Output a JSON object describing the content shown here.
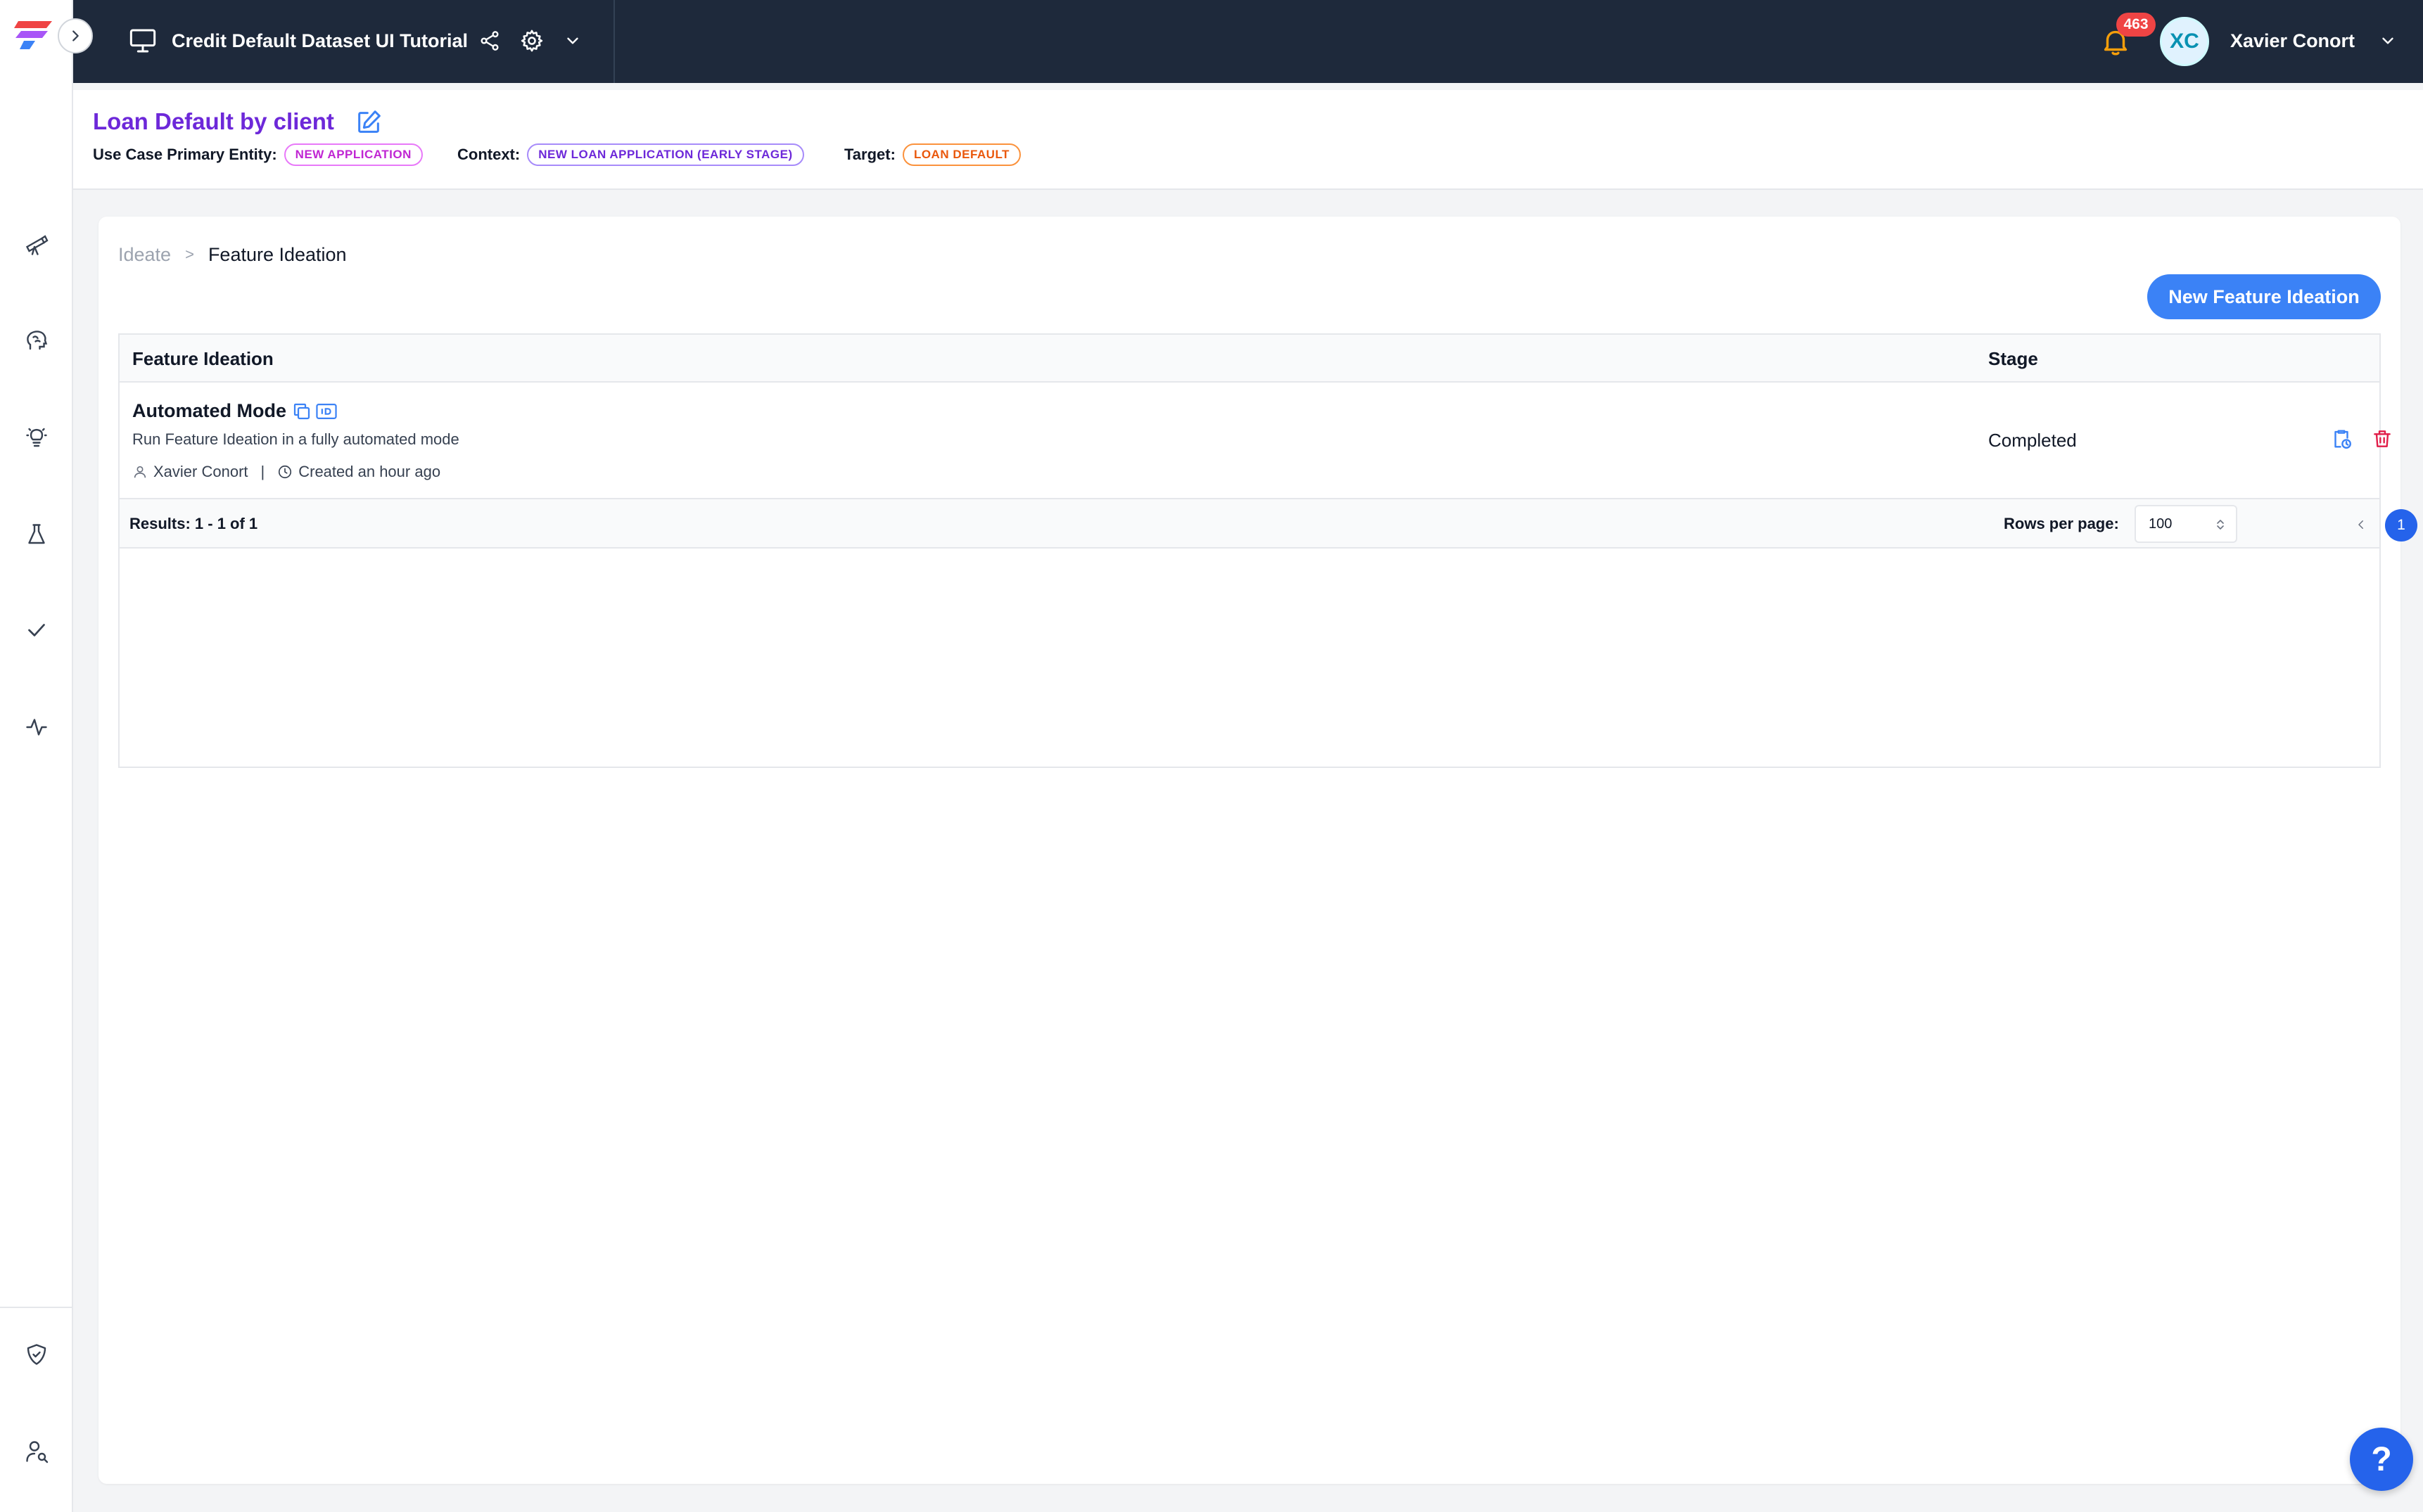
{
  "app": {
    "project_title": "Credit Default Dataset UI Tutorial",
    "notifications_count": "463",
    "user_initials": "XC",
    "user_name": "Xavier Conort",
    "accent_color": "#3b82f6",
    "topbar_color": "#1e293b"
  },
  "use_case": {
    "title": "Loan Default by client",
    "primary_entity_label": "Use Case Primary Entity:",
    "primary_entity_value": "NEW APPLICATION",
    "context_label": "Context:",
    "context_value": "NEW LOAN APPLICATION (EARLY STAGE)",
    "target_label": "Target:",
    "target_value": "LOAN DEFAULT"
  },
  "sidebar": {
    "items": [
      {
        "icon": "telescope-icon"
      },
      {
        "icon": "brain-icon"
      },
      {
        "icon": "lightbulb-icon"
      },
      {
        "icon": "flask-icon"
      },
      {
        "icon": "check-icon"
      },
      {
        "icon": "pulse-icon"
      },
      {
        "icon": "shield-icon"
      },
      {
        "icon": "user-search-icon"
      }
    ]
  },
  "breadcrumb": {
    "parent": "Ideate",
    "separator": ">",
    "current": "Feature Ideation"
  },
  "actions": {
    "new_label": "New Feature Ideation"
  },
  "table": {
    "columns": [
      "Feature Ideation",
      "Stage"
    ],
    "rows": [
      {
        "name": "Automated Mode",
        "description": "Run Feature Ideation in a fully automated mode",
        "owner": "Xavier Conort",
        "divider": "|",
        "created": "Created an hour ago",
        "stage": "Completed"
      }
    ],
    "results_text": "Results: 1 - 1 of 1",
    "rows_per_page_label": "Rows per page:",
    "rows_per_page_value": "100",
    "current_page": "1"
  },
  "help": {
    "label": "?"
  }
}
